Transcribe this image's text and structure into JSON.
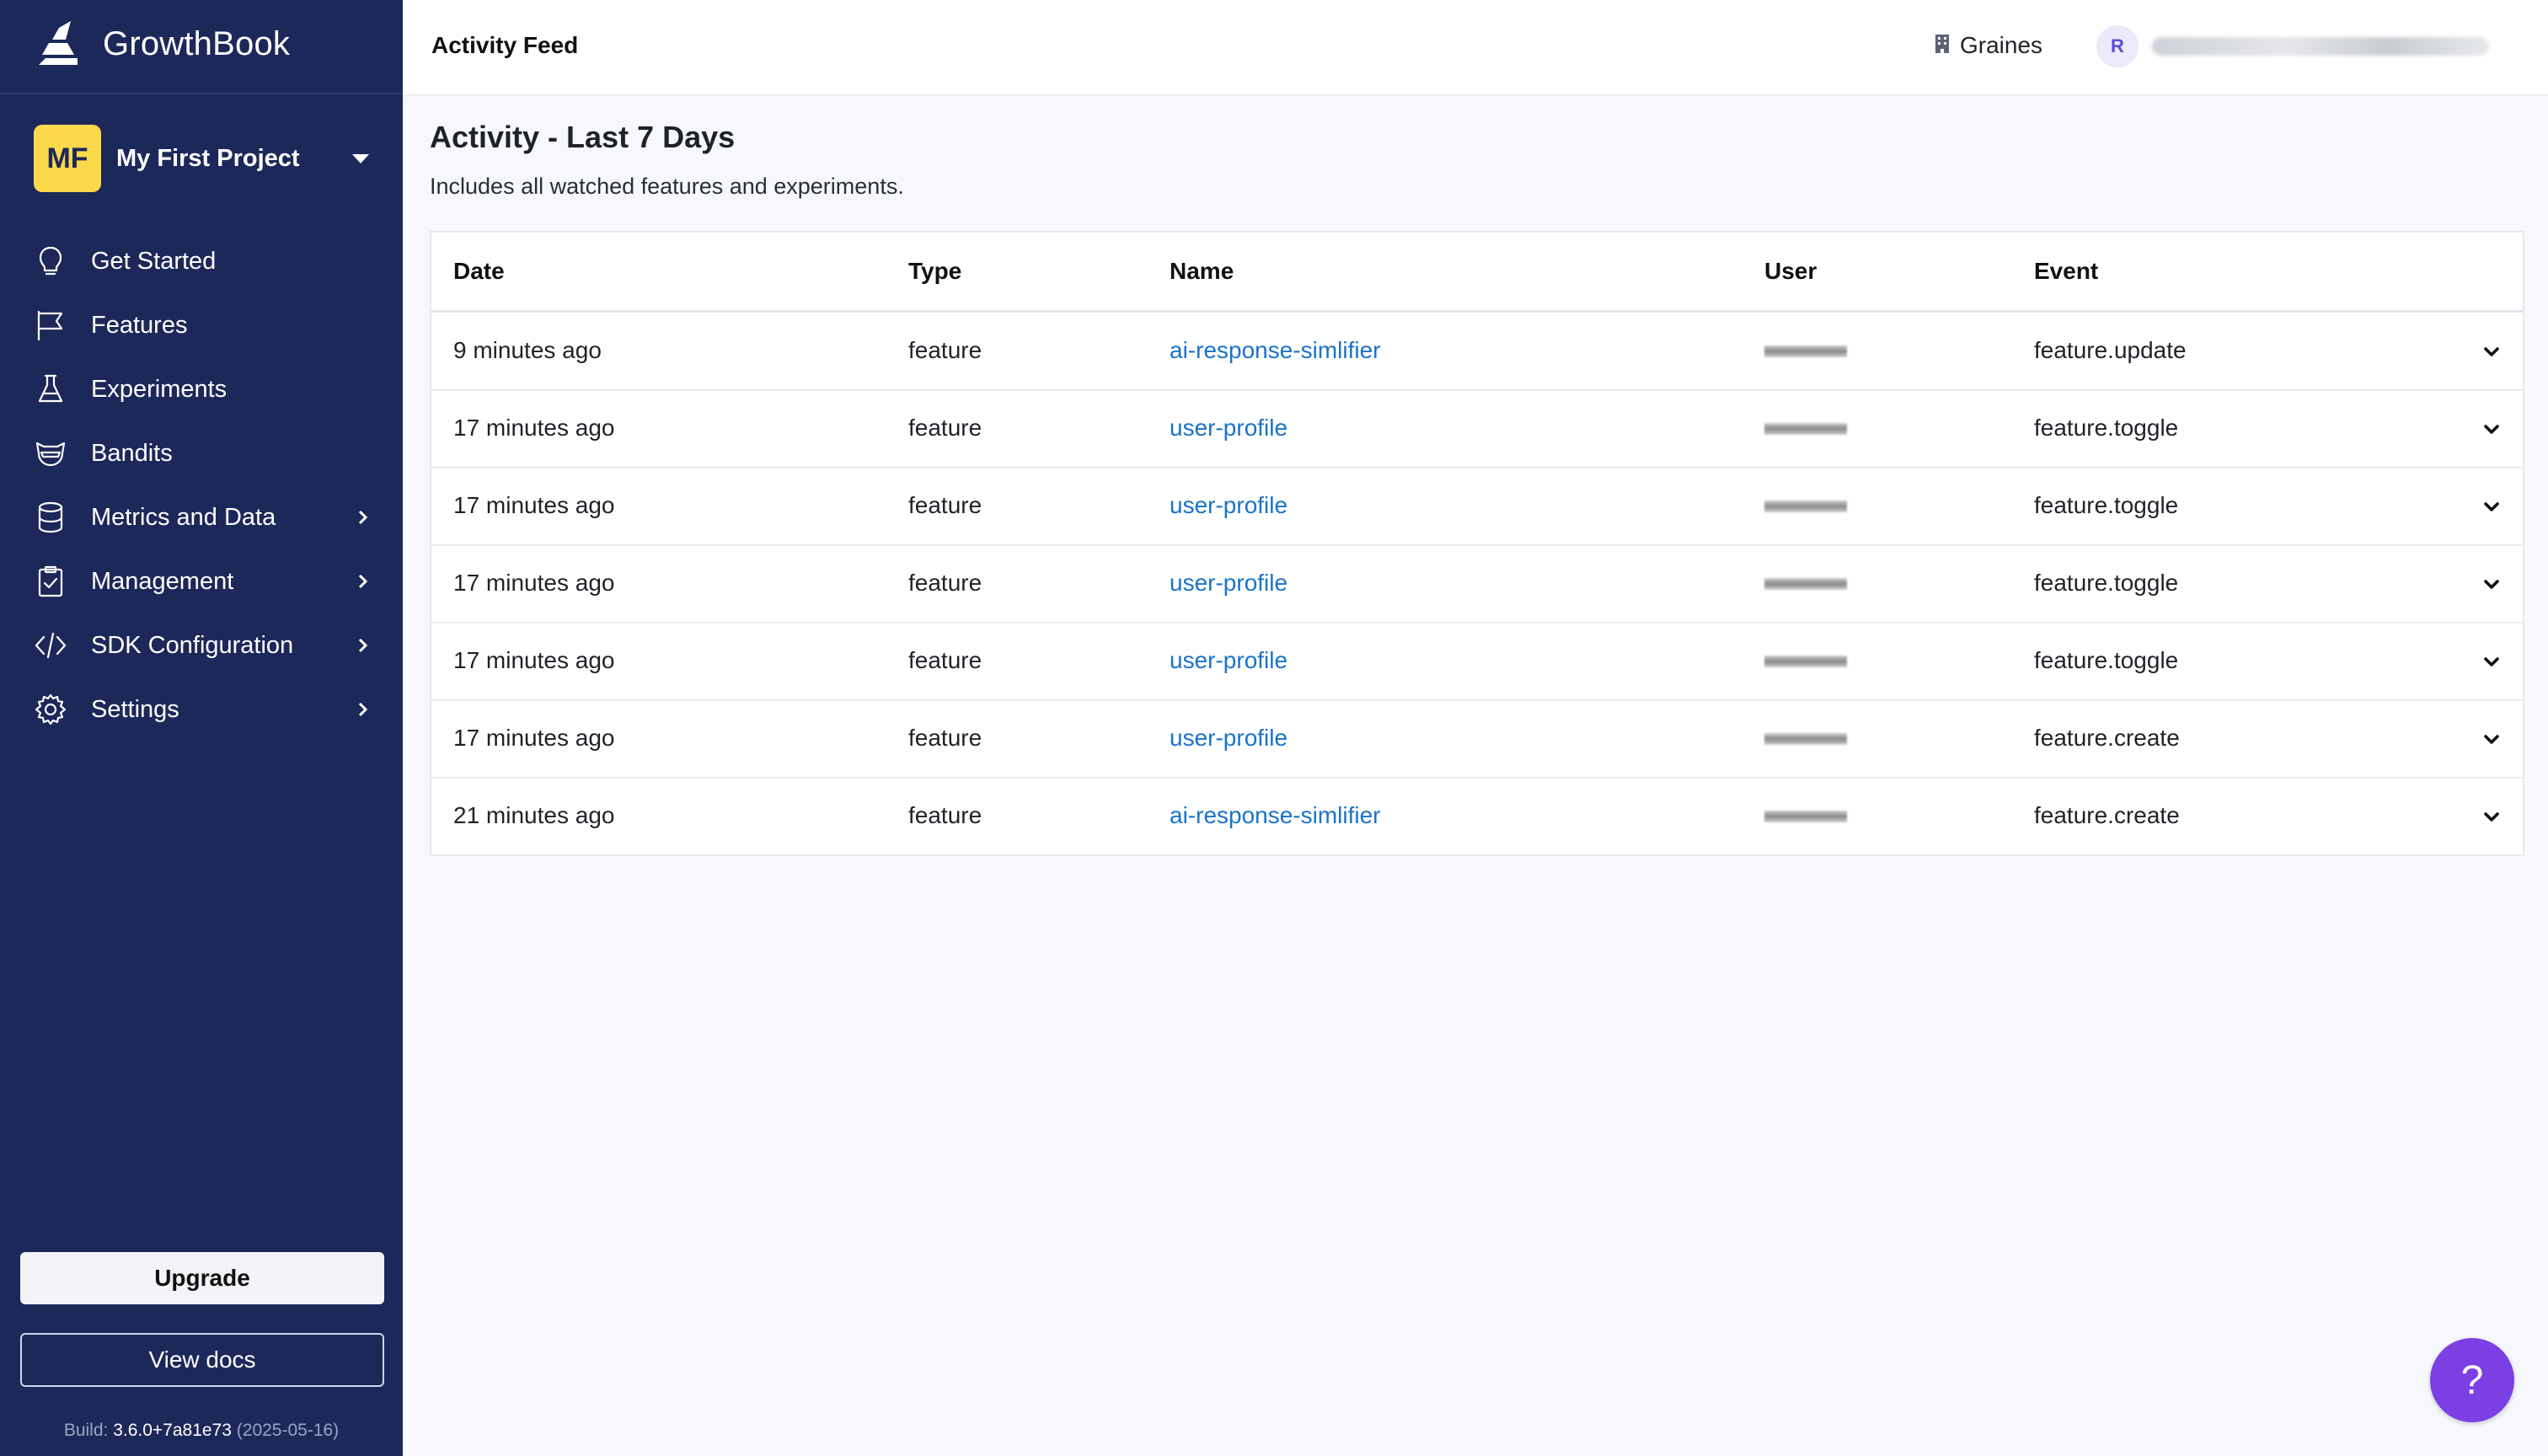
{
  "brand": {
    "name": "GrowthBook"
  },
  "project": {
    "initials": "MF",
    "name": "My First Project"
  },
  "sidebar": {
    "items": [
      {
        "label": "Get Started",
        "icon": "lightbulb-icon",
        "has_submenu": false
      },
      {
        "label": "Features",
        "icon": "flag-icon",
        "has_submenu": false
      },
      {
        "label": "Experiments",
        "icon": "beaker-icon",
        "has_submenu": false
      },
      {
        "label": "Bandits",
        "icon": "bandit-icon",
        "has_submenu": false
      },
      {
        "label": "Metrics and Data",
        "icon": "database-icon",
        "has_submenu": true
      },
      {
        "label": "Management",
        "icon": "clipboard-icon",
        "has_submenu": true
      },
      {
        "label": "SDK Configuration",
        "icon": "code-icon",
        "has_submenu": true
      },
      {
        "label": "Settings",
        "icon": "gear-icon",
        "has_submenu": true
      }
    ],
    "upgrade_label": "Upgrade",
    "docs_label": "View docs",
    "build_prefix": "Build:",
    "build_version": "3.6.0+7a81e73",
    "build_date": "(2025-05-16)"
  },
  "topbar": {
    "title": "Activity Feed",
    "org_name": "Graines",
    "user_initial": "R"
  },
  "main": {
    "title": "Activity - Last 7 Days",
    "subtitle": "Includes all watched features and experiments."
  },
  "table": {
    "columns": [
      "Date",
      "Type",
      "Name",
      "User",
      "Event"
    ],
    "rows": [
      {
        "date": "9 minutes ago",
        "type": "feature",
        "name": "ai-response-simlifier",
        "event": "feature.update"
      },
      {
        "date": "17 minutes ago",
        "type": "feature",
        "name": "user-profile",
        "event": "feature.toggle"
      },
      {
        "date": "17 minutes ago",
        "type": "feature",
        "name": "user-profile",
        "event": "feature.toggle"
      },
      {
        "date": "17 minutes ago",
        "type": "feature",
        "name": "user-profile",
        "event": "feature.toggle"
      },
      {
        "date": "17 minutes ago",
        "type": "feature",
        "name": "user-profile",
        "event": "feature.toggle"
      },
      {
        "date": "17 minutes ago",
        "type": "feature",
        "name": "user-profile",
        "event": "feature.create"
      },
      {
        "date": "21 minutes ago",
        "type": "feature",
        "name": "ai-response-simlifier",
        "event": "feature.create"
      }
    ]
  },
  "help": {
    "label": "?"
  },
  "colors": {
    "sidebar_bg": "#1d285a",
    "project_avatar": "#fcd94a",
    "link": "#1a73c9",
    "help_button": "#7b3fe4"
  }
}
